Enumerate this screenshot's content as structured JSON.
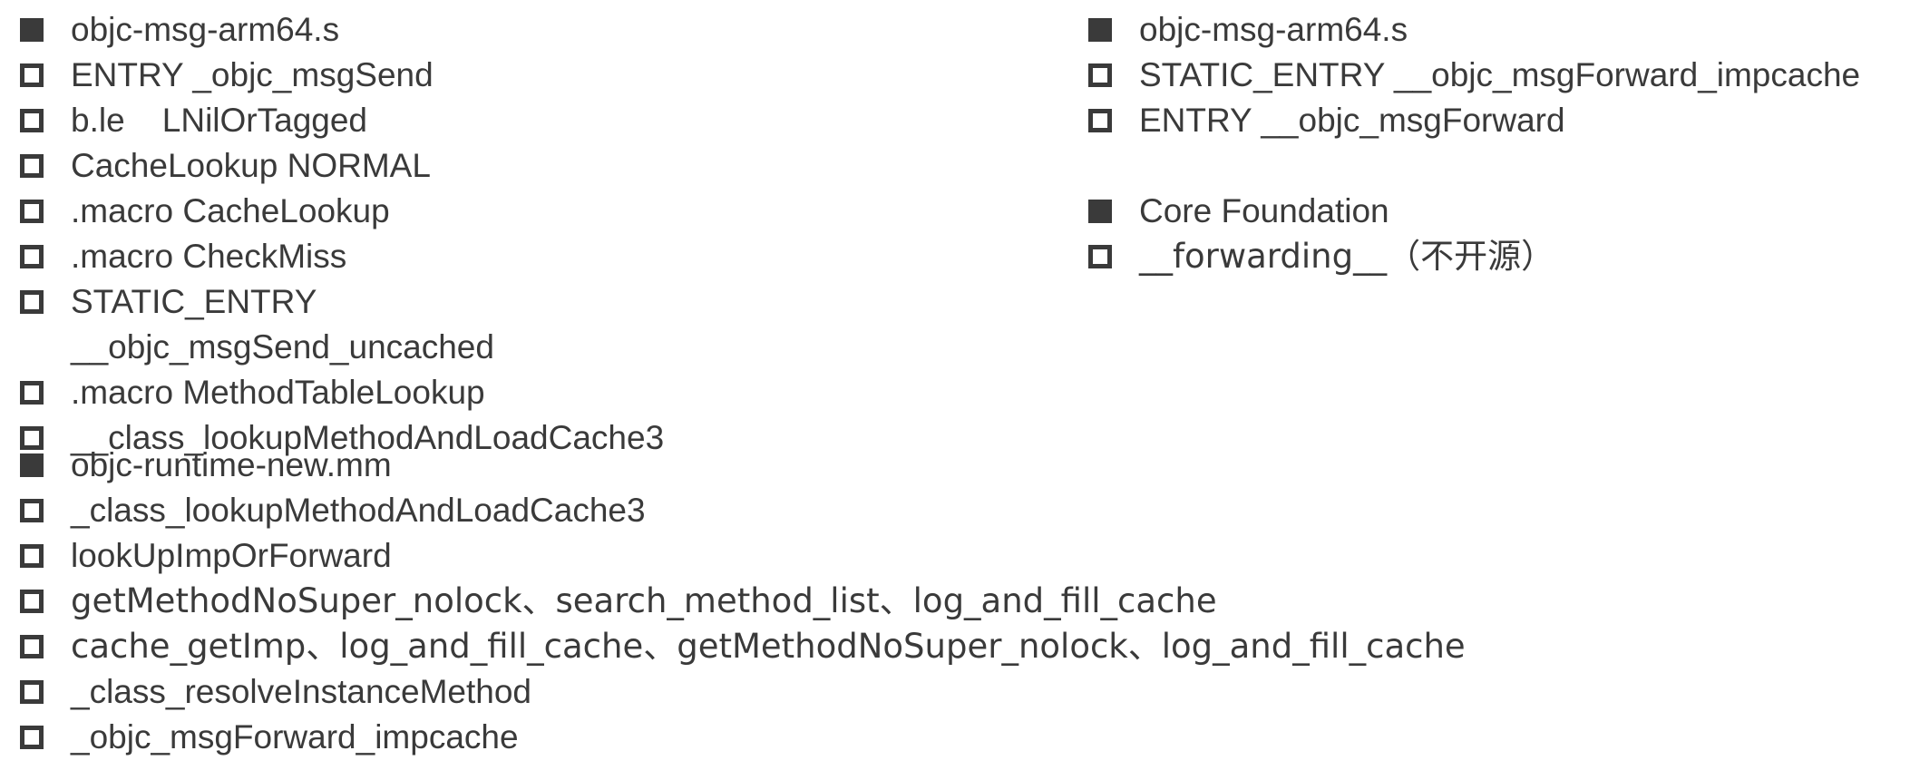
{
  "left_column": {
    "group_arm64": {
      "title": "objc-msg-arm64.s",
      "items": [
        "ENTRY _objc_msgSend",
        "b.le    LNilOrTagged",
        "CacheLookup NORMAL",
        ".macro CacheLookup",
        ".macro CheckMiss",
        "STATIC_ENTRY",
        "__objc_msgSend_uncached",
        ".macro MethodTableLookup",
        "__class_lookupMethodAndLoadCache3"
      ]
    },
    "group_runtime": {
      "title": "objc-runtime-new.mm",
      "items": [
        "_class_lookupMethodAndLoadCache3",
        "lookUpImpOrForward",
        "getMethodNoSuper_nolock、search_method_list、log_and_fill_cache",
        "cache_getImp、log_and_fill_cache、getMethodNoSuper_nolock、log_and_fill_cache",
        "_class_resolveInstanceMethod",
        "_objc_msgForward_impcache"
      ]
    }
  },
  "right_column": {
    "group_arm64": {
      "title": "objc-msg-arm64.s",
      "items": [
        "STATIC_ENTRY __objc_msgForward_impcache",
        "ENTRY __objc_msgForward"
      ]
    },
    "group_cf": {
      "title": "Core Foundation",
      "items": [
        "__forwarding__（不开源）"
      ]
    }
  }
}
